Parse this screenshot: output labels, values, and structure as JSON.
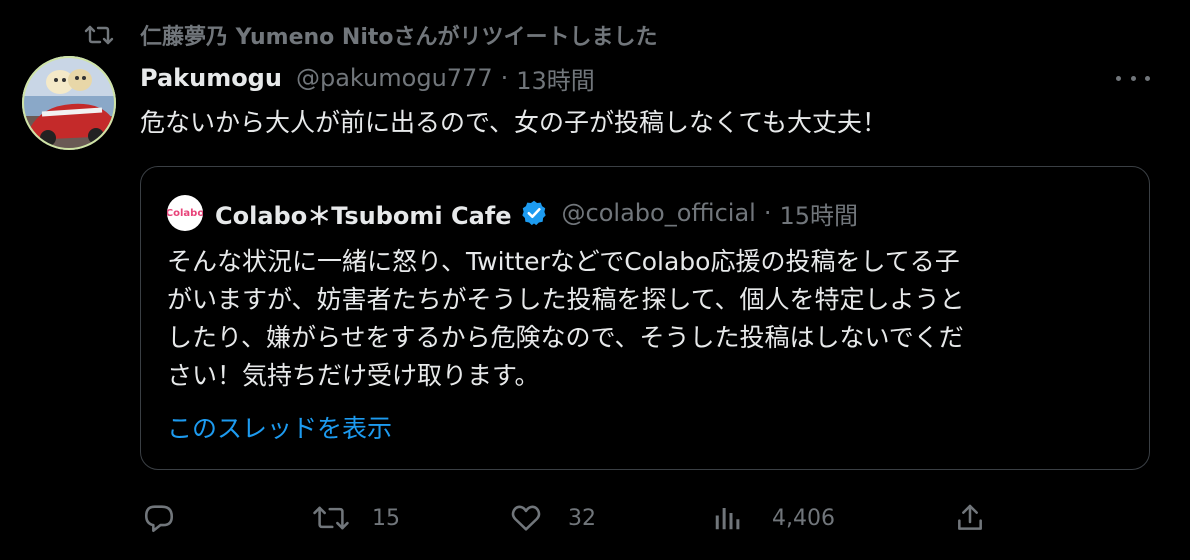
{
  "retweet_bar": {
    "text": "仁藤夢乃  Yumeno Nitoさんがリツイートしました",
    "icon": "retweet-icon"
  },
  "tweet": {
    "display_name": "Pakumogu",
    "handle": "@pakumogu777",
    "separator": "·",
    "time": "13時間",
    "text": "危ないから大人が前に出るので、女の子が投稿しなくても大丈夫！"
  },
  "quoted_tweet": {
    "avatar_text": "Colabo",
    "display_name": "Colabo＊Tsubomi Cafe",
    "handle": "@colabo_official",
    "separator": "·",
    "time": "15時間",
    "lines": [
      "そんな状況に一緒に怒り、TwitterなどでColabo応援の投稿をしてる子",
      "がいますが、妨害者たちがそうした投稿を探して、個人を特定しようと",
      "したり、嫌がらせをするから危険なので、そうした投稿はしないでくだ",
      "さい！気持ちだけ受け取ります。"
    ],
    "show_thread": "このスレッドを表示"
  },
  "actions": {
    "reply_count": "",
    "retweet_count": "15",
    "like_count": "32",
    "views_count": "4,406"
  },
  "colors": {
    "accent": "#1d9bf0",
    "muted": "#71767b",
    "verified": "#1d9bf0"
  }
}
